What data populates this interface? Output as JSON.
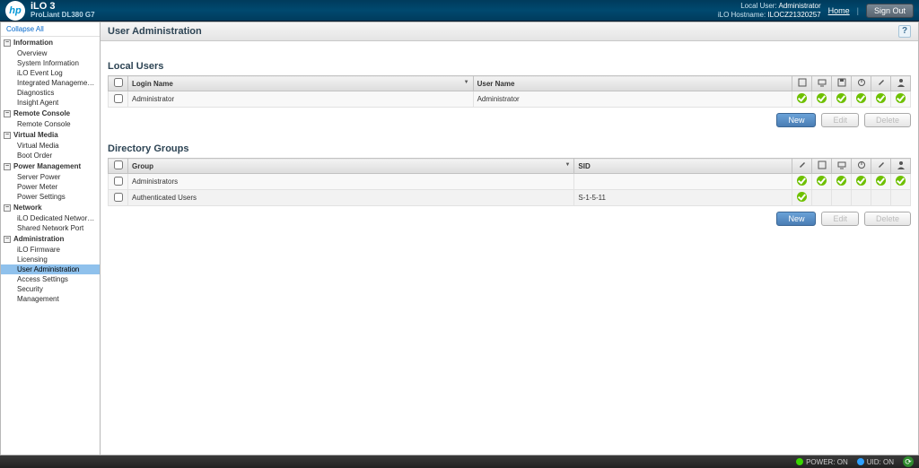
{
  "header": {
    "product": "iLO 3",
    "model": "ProLiant DL380 G7",
    "local_user_label": "Local User:",
    "local_user": "Administrator",
    "host_label": "iLO Hostname:",
    "host": "ILOCZ21320257",
    "home": "Home",
    "signout": "Sign Out"
  },
  "sidebar": {
    "collapse_all": "Collapse All",
    "groups": [
      {
        "title": "Information",
        "items": [
          "Overview",
          "System Information",
          "iLO Event Log",
          "Integrated Management Log",
          "Diagnostics",
          "Insight Agent"
        ]
      },
      {
        "title": "Remote Console",
        "items": [
          "Remote Console"
        ]
      },
      {
        "title": "Virtual Media",
        "items": [
          "Virtual Media",
          "Boot Order"
        ]
      },
      {
        "title": "Power Management",
        "items": [
          "Server Power",
          "Power Meter",
          "Power Settings"
        ]
      },
      {
        "title": "Network",
        "items": [
          "iLO Dedicated Network Port",
          "Shared Network Port"
        ]
      },
      {
        "title": "Administration",
        "items": [
          "iLO Firmware",
          "Licensing",
          "User Administration",
          "Access Settings",
          "Security",
          "Management"
        ],
        "selected_index": 2
      }
    ]
  },
  "page": {
    "title": "User Administration",
    "sections": {
      "local_users": {
        "title": "Local Users",
        "columns": {
          "login": "Login Name",
          "user": "User Name"
        },
        "iconcols": [
          "admin",
          "console",
          "media",
          "power",
          "config",
          "user"
        ],
        "rows": [
          {
            "login": "Administrator",
            "user": "Administrator",
            "perms": [
              true,
              true,
              true,
              true,
              true,
              true
            ]
          }
        ],
        "buttons": {
          "new": "New",
          "edit": "Edit",
          "delete": "Delete"
        }
      },
      "directory_groups": {
        "title": "Directory Groups",
        "columns": {
          "group": "Group",
          "sid": "SID"
        },
        "iconcols": [
          "admin",
          "console",
          "media",
          "power",
          "config",
          "user"
        ],
        "rows": [
          {
            "group": "Administrators",
            "sid": "",
            "perms": [
              true,
              true,
              true,
              true,
              true,
              true
            ]
          },
          {
            "group": "Authenticated Users",
            "sid": "S-1-5-11",
            "perms": [
              true,
              null,
              null,
              null,
              null,
              null
            ]
          }
        ],
        "buttons": {
          "new": "New",
          "edit": "Edit",
          "delete": "Delete"
        }
      }
    }
  },
  "footer": {
    "power_label": "POWER: ON",
    "uid_label": "UID: ON"
  }
}
